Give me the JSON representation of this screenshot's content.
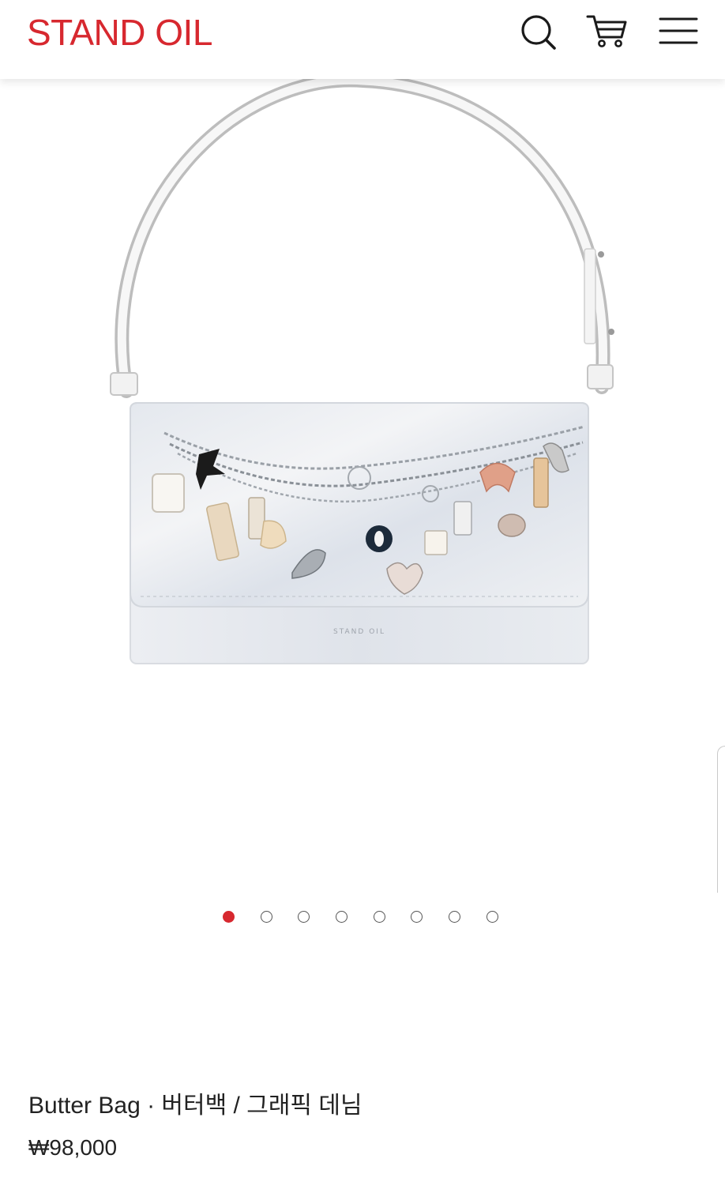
{
  "header": {
    "logo_text": "STAND OIL",
    "brand_color": "#d7282f",
    "icons": [
      "search-icon",
      "cart-icon",
      "menu-icon"
    ]
  },
  "gallery": {
    "slide_count": 8,
    "active_slide": 1,
    "active_dot_color": "#d7282f"
  },
  "product": {
    "name": "Butter Bag · 버터백 / 그래픽 데님",
    "price": "₩98,000"
  }
}
